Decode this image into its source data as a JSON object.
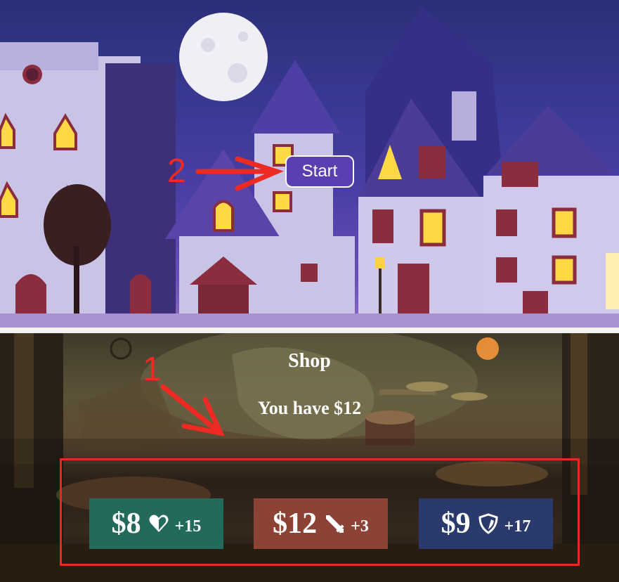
{
  "start_button": {
    "label": "Start"
  },
  "shop": {
    "title": "Shop",
    "money_text": "You have $12",
    "items": [
      {
        "price": "$8",
        "icon": "heart-icon",
        "bonus": "+15",
        "color": "#226a5c"
      },
      {
        "price": "$12",
        "icon": "sword-icon",
        "bonus": "+3",
        "color": "#8d4236"
      },
      {
        "price": "$9",
        "icon": "shield-icon",
        "bonus": "+17",
        "color": "#2a3a6c"
      }
    ]
  },
  "annotations": {
    "labels": [
      "1",
      "2"
    ],
    "color": "#ee2b22"
  }
}
